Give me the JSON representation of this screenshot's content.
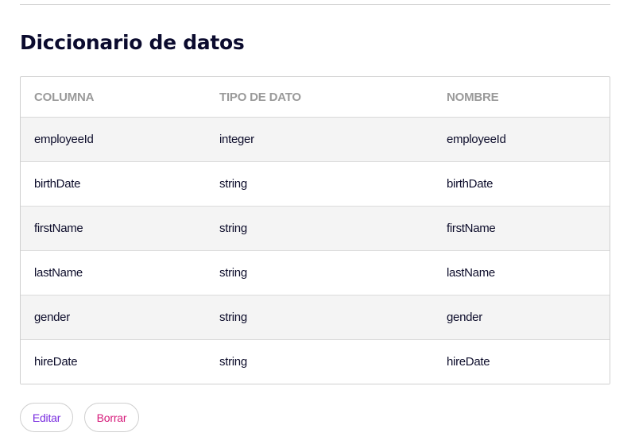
{
  "section": {
    "title": "Diccionario de datos"
  },
  "table": {
    "headers": [
      "COLUMNA",
      "TIPO DE DATO",
      "NOMBRE"
    ],
    "rows": [
      [
        "employeeId",
        "integer",
        "employeeId"
      ],
      [
        "birthDate",
        "string",
        "birthDate"
      ],
      [
        "firstName",
        "string",
        "firstName"
      ],
      [
        "lastName",
        "string",
        "lastName"
      ],
      [
        "gender",
        "string",
        "gender"
      ],
      [
        "hireDate",
        "string",
        "hireDate"
      ]
    ]
  },
  "actions": {
    "edit_label": "Editar",
    "delete_label": "Borrar"
  },
  "colors": {
    "edit": "#7a2ee0",
    "delete": "#d61a7a",
    "header_text": "#9a9a9a",
    "stripe": "#f4f4f4"
  }
}
